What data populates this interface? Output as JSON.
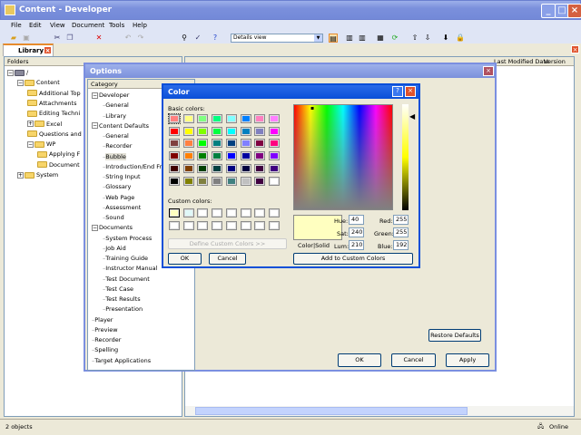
{
  "window": {
    "title": "Content - Developer"
  },
  "menu": [
    "File",
    "Edit",
    "View",
    "Document",
    "Tools",
    "Help"
  ],
  "toolbar": {
    "view_select": "Details view"
  },
  "library_tab": "Library",
  "folders": {
    "header": "Folders",
    "root": "/",
    "items": [
      "Content",
      "Additional Top",
      "Attachments",
      "Editing Techni",
      "Excel",
      "Questions and",
      "WP",
      "Applying F",
      "Document",
      "System"
    ]
  },
  "list": {
    "columns": [
      "Last Modified Date",
      "Version"
    ]
  },
  "status": {
    "count": "2 objects",
    "connection": "Online"
  },
  "options": {
    "title": "Options",
    "category_header": "Category",
    "tree": [
      [
        "Developer",
        0
      ],
      [
        "General",
        1
      ],
      [
        "Library",
        1
      ],
      [
        "Content Defaults",
        0
      ],
      [
        "General",
        1
      ],
      [
        "Recorder",
        1
      ],
      [
        "Bubble",
        1
      ],
      [
        "Introduction/End Fr",
        1
      ],
      [
        "String Input",
        1
      ],
      [
        "Glossary",
        1
      ],
      [
        "Web Page",
        1
      ],
      [
        "Assessment",
        1
      ],
      [
        "Sound",
        1
      ],
      [
        "Documents",
        0
      ],
      [
        "System Process",
        1
      ],
      [
        "Job Aid",
        1
      ],
      [
        "Training Guide",
        1
      ],
      [
        "Instructor Manual",
        1
      ],
      [
        "Test Document",
        1
      ],
      [
        "Test Case",
        1
      ],
      [
        "Test Results",
        1
      ],
      [
        "Presentation",
        1
      ],
      [
        "Player",
        0
      ],
      [
        "Preview",
        0
      ],
      [
        "Recorder",
        0
      ],
      [
        "Spelling",
        0
      ],
      [
        "Target Applications",
        0
      ]
    ],
    "selected": "Bubble",
    "restore": "Restore Defaults",
    "ok": "OK",
    "cancel": "Cancel",
    "apply": "Apply"
  },
  "color": {
    "title": "Color",
    "basic_label": "Basic colors:",
    "custom_label": "Custom colors:",
    "basic": [
      "#FF8080",
      "#FFFF80",
      "#80FF80",
      "#00FF80",
      "#80FFFF",
      "#0080FF",
      "#FF80C0",
      "#FF80FF",
      "#FF0000",
      "#FFFF00",
      "#80FF00",
      "#00FF40",
      "#00FFFF",
      "#0080C0",
      "#8080C0",
      "#FF00FF",
      "#804040",
      "#FF8040",
      "#00FF00",
      "#008080",
      "#004080",
      "#8080FF",
      "#800040",
      "#FF0080",
      "#800000",
      "#FF8000",
      "#008000",
      "#008040",
      "#0000FF",
      "#0000A0",
      "#800080",
      "#8000FF",
      "#400000",
      "#804000",
      "#004000",
      "#004040",
      "#000080",
      "#000040",
      "#400040",
      "#400080",
      "#000000",
      "#808000",
      "#808040",
      "#808080",
      "#408080",
      "#C0C0C0",
      "#400040",
      "#FFFFFF"
    ],
    "custom": [
      "#FFFFC0",
      "#E0F8F8",
      "#FFFFFF",
      "#FFFFFF",
      "#FFFFFF",
      "#FFFFFF",
      "#FFFFFF",
      "#FFFFFF",
      "#FFFFFF",
      "#FFFFFF",
      "#FFFFFF",
      "#FFFFFF",
      "#FFFFFF",
      "#FFFFFF",
      "#FFFFFF",
      "#FFFFFF"
    ],
    "define": "Define Custom Colors >>",
    "ok": "OK",
    "cancel": "Cancel",
    "color_solid": "Color|Solid",
    "hue_label": "Hue:",
    "hue": "40",
    "sat_label": "Sat:",
    "sat": "240",
    "lum_label": "Lum:",
    "lum": "210",
    "red_label": "Red:",
    "red": "255",
    "green_label": "Green:",
    "green": "255",
    "blue_label": "Blue:",
    "blue": "192",
    "add": "Add to Custom Colors",
    "current": "#FFFFC0"
  }
}
